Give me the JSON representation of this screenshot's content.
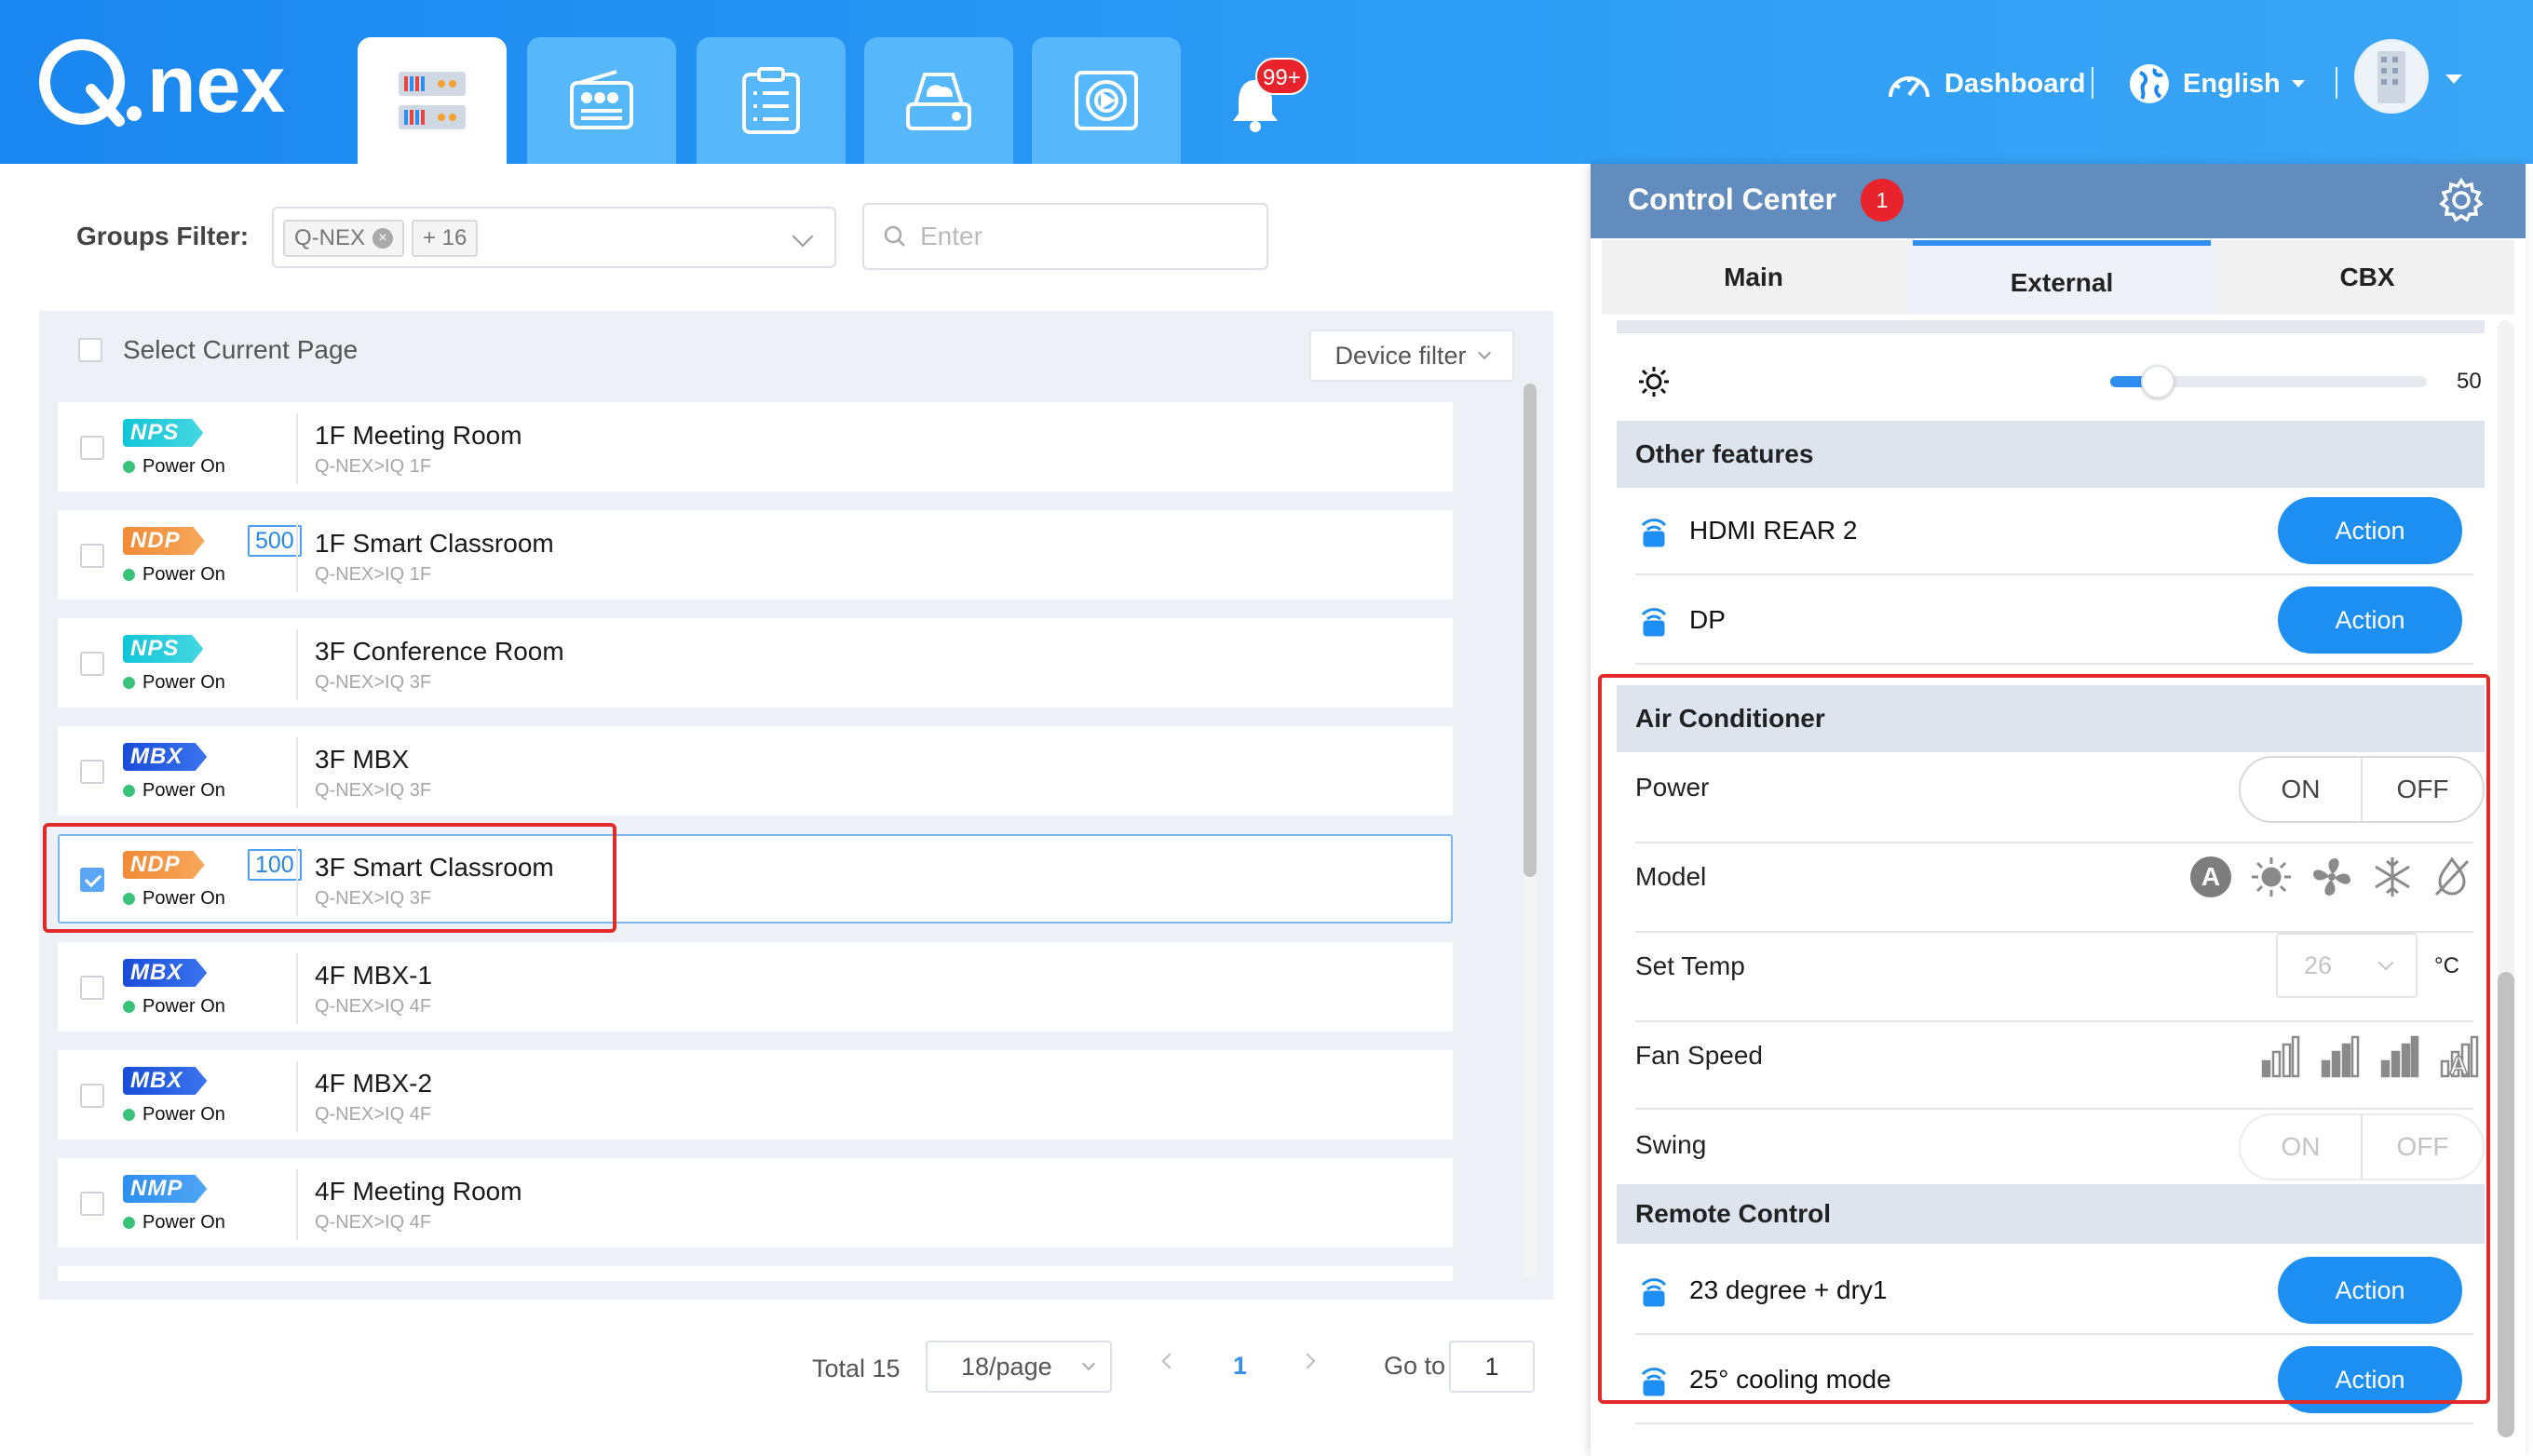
{
  "header": {
    "logo_text": "Q.nex",
    "nav_tabs": [
      {
        "name": "device-manager-tab",
        "icon": "device-rack-icon",
        "active": true
      },
      {
        "name": "radio-tab",
        "icon": "radio-icon",
        "active": false
      },
      {
        "name": "schedule-tab",
        "icon": "clipboard-icon",
        "active": false
      },
      {
        "name": "storage-tab",
        "icon": "cloud-drive-icon",
        "active": false
      },
      {
        "name": "media-tab",
        "icon": "media-player-icon",
        "active": false
      }
    ],
    "notification_count": "99+",
    "dashboard_label": "Dashboard",
    "language_label": "English",
    "colors": {
      "header_from": "#1a86f0",
      "header_to": "#3aa6f6",
      "tab_bg": "#56b8fb"
    }
  },
  "filters": {
    "groups_label": "Groups Filter:",
    "group_tag": "Q-NEX",
    "more_tag": "+ 16",
    "search_placeholder": "Enter"
  },
  "device_list": {
    "select_page_label": "Select Current Page",
    "device_filter_label": "Device filter",
    "rows": [
      {
        "type": "NPS",
        "count": "",
        "status": "Power On",
        "title": "1F Meeting Room",
        "path": "Q-NEX>IQ 1F",
        "checked": false
      },
      {
        "type": "NDP",
        "count": "500",
        "status": "Power On",
        "title": "1F Smart Classroom",
        "path": "Q-NEX>IQ 1F",
        "checked": false
      },
      {
        "type": "NPS",
        "count": "",
        "status": "Power On",
        "title": "3F Conference Room",
        "path": "Q-NEX>IQ 3F",
        "checked": false
      },
      {
        "type": "MBX",
        "count": "",
        "status": "Power On",
        "title": "3F MBX",
        "path": "Q-NEX>IQ 3F",
        "checked": false
      },
      {
        "type": "NDP",
        "count": "100",
        "status": "Power On",
        "title": "3F Smart Classroom",
        "path": "Q-NEX>IQ 3F",
        "checked": true
      },
      {
        "type": "MBX",
        "count": "",
        "status": "Power On",
        "title": "4F MBX-1",
        "path": "Q-NEX>IQ 4F",
        "checked": false
      },
      {
        "type": "MBX",
        "count": "",
        "status": "Power On",
        "title": "4F MBX-2",
        "path": "Q-NEX>IQ 4F",
        "checked": false
      },
      {
        "type": "NMP",
        "count": "",
        "status": "Power On",
        "title": "4F Meeting Room",
        "path": "Q-NEX>IQ 4F",
        "checked": false
      }
    ]
  },
  "pagination": {
    "total_label": "Total 15",
    "page_size": "18/page",
    "current_page": "1",
    "goto_label": "Go to",
    "goto_value": "1"
  },
  "control_center": {
    "title": "Control Center",
    "badge": "1",
    "tabs": [
      {
        "label": "Main",
        "active": false
      },
      {
        "label": "External",
        "active": true
      },
      {
        "label": "CBX",
        "active": false
      }
    ],
    "brightness": {
      "icon": "brightness-icon",
      "value": "50",
      "level": 0.15
    },
    "other_features": {
      "title": "Other features",
      "items": [
        {
          "name": "HDMI REAR 2",
          "action_label": "Action"
        },
        {
          "name": "DP",
          "action_label": "Action"
        }
      ]
    },
    "air_conditioner": {
      "title": "Air Conditioner",
      "power_label": "Power",
      "power_on": "ON",
      "power_off": "OFF",
      "model_label": "Model",
      "model_icons": [
        "auto-mode-icon",
        "sun-heat-icon",
        "fan-icon",
        "snowflake-cool-icon",
        "dry-mode-icon"
      ],
      "set_temp_label": "Set Temp",
      "set_temp_value": "26",
      "temp_unit": "°C",
      "fan_speed_label": "Fan Speed",
      "fan_icons": [
        "fan-speed-low-icon",
        "fan-speed-medium-icon",
        "fan-speed-high-icon",
        "fan-speed-auto-icon"
      ],
      "swing_label": "Swing",
      "swing_on": "ON",
      "swing_off": "OFF"
    },
    "remote_control": {
      "title": "Remote Control",
      "items": [
        {
          "name": "23 degree + dry1",
          "action_label": "Action"
        },
        {
          "name": "25° cooling mode",
          "action_label": "Action"
        }
      ]
    },
    "colors": {
      "head_bg": "#628bbe",
      "action": "#1d8ff2",
      "section_bg": "#dde4ee"
    }
  }
}
